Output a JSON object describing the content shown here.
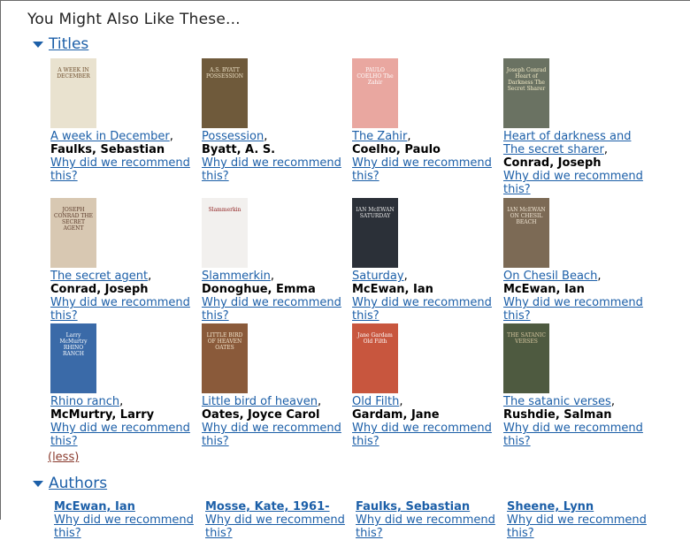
{
  "heading": "You Might Also Like These...",
  "titles_section": {
    "label": "Titles"
  },
  "authors_section": {
    "label": "Authors"
  },
  "less_label": "(less)",
  "why_label": "Why did we recommend this?",
  "books": [
    {
      "title": "A week in December",
      "author": "Faulks, Sebastian",
      "cover_color": "#e9e2cf",
      "cover_text": "A WEEK IN DECEMBER",
      "cover_text_color": "#6b4b2a"
    },
    {
      "title": "Possession",
      "author": "Byatt, A. S.",
      "cover_color": "#6f5a3b",
      "cover_text": "A.S. BYATT POSSESSION",
      "cover_text_color": "#efe3c8"
    },
    {
      "title": "The Zahir",
      "author": "Coelho, Paulo",
      "cover_color": "#e9a7a0",
      "cover_text": "PAULO COELHO The Zahir",
      "cover_text_color": "#ffffff"
    },
    {
      "title": "Heart of darkness and The secret sharer",
      "author": "Conrad, Joseph",
      "cover_color": "#6a7262",
      "cover_text": "Joseph Conrad Heart of Darkness The Secret Sharer",
      "cover_text_color": "#f2eac6"
    },
    {
      "title": "The secret agent",
      "author": "Conrad, Joseph",
      "cover_color": "#d8c8b2",
      "cover_text": "JOSEPH CONRAD THE SECRET AGENT",
      "cover_text_color": "#5a3a2a"
    },
    {
      "title": "Slammerkin",
      "author": "Donoghue, Emma",
      "cover_color": "#f2f0ee",
      "cover_text": "Slammerkin",
      "cover_text_color": "#8d1b1b"
    },
    {
      "title": "Saturday",
      "author": "McEwan, Ian",
      "cover_color": "#2b3038",
      "cover_text": "IAN McEWAN SATURDAY",
      "cover_text_color": "#e8e8e8"
    },
    {
      "title": "On Chesil Beach",
      "author": "McEwan, Ian",
      "cover_color": "#7c6a55",
      "cover_text": "IAN McEWAN ON CHESIL BEACH",
      "cover_text_color": "#f1e6d4"
    },
    {
      "title": "Rhino ranch",
      "author": "McMurtry, Larry",
      "cover_color": "#3a6aa8",
      "cover_text": "Larry McMurtry RHINO RANCH",
      "cover_text_color": "#ffffff"
    },
    {
      "title": "Little bird of heaven",
      "author": "Oates, Joyce Carol",
      "cover_color": "#8a5a3a",
      "cover_text": "LITTLE BIRD OF HEAVEN OATES",
      "cover_text_color": "#f4e7cf"
    },
    {
      "title": "Old Filth",
      "author": "Gardam, Jane",
      "cover_color": "#c8563e",
      "cover_text": "Jane Gardam Old Filth",
      "cover_text_color": "#ffffff"
    },
    {
      "title": "The satanic verses",
      "author": "Rushdie, Salman",
      "cover_color": "#4e5a40",
      "cover_text": "THE SATANIC VERSES",
      "cover_text_color": "#d7c7a0"
    }
  ],
  "authors": [
    {
      "name": "McEwan, Ian"
    },
    {
      "name": "Mosse, Kate, 1961-"
    },
    {
      "name": "Faulks, Sebastian"
    },
    {
      "name": "Sheene, Lynn"
    }
  ]
}
